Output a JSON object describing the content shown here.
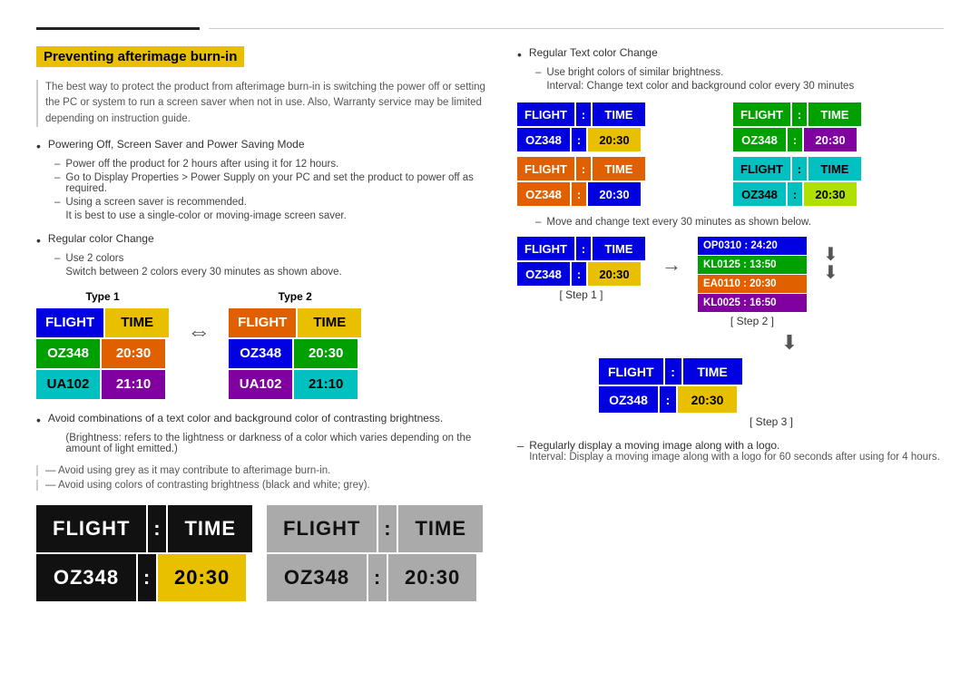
{
  "page": {
    "topLine": {}
  },
  "left": {
    "sectionTitle": "Preventing afterimage burn-in",
    "intro": "The best way to protect the product from afterimage burn-in is switching the power off or setting the PC or system to run a screen saver when not in use. Also, Warranty service may be limited depending on instruction guide.",
    "bullets": [
      {
        "text": "Powering Off, Screen Saver and Power Saving Mode",
        "subs": [
          "Power off the product for 2 hours after using it for 12 hours.",
          "Go to Display Properties > Power Supply on your PC and set the product to power off as required.",
          "Using a screen saver is recommended.",
          "It is best to use a single-color or moving-image screen saver."
        ]
      },
      {
        "text": "Regular color Change",
        "subs": [
          "Use 2 colors",
          "Switch between 2 colors every 30 minutes as shown above."
        ]
      }
    ],
    "type1Label": "Type 1",
    "type2Label": "Type 2",
    "type1Board": {
      "row1": [
        {
          "text": "FLIGHT",
          "color": "blue"
        },
        {
          "text": "TIME",
          "color": "yellow"
        }
      ],
      "row2": [
        {
          "text": "OZ348",
          "color": "green"
        },
        {
          "text": "20:30",
          "color": "orange"
        }
      ],
      "row3": [
        {
          "text": "UA102",
          "color": "cyan"
        },
        {
          "text": "21:10",
          "color": "purple"
        }
      ]
    },
    "type2Board": {
      "row1": [
        {
          "text": "FLIGHT",
          "color": "orange"
        },
        {
          "text": "TIME",
          "color": "yellow"
        }
      ],
      "row2": [
        {
          "text": "OZ348",
          "color": "blue"
        },
        {
          "text": "20:30",
          "color": "green"
        }
      ],
      "row3": [
        {
          "text": "UA102",
          "color": "purple"
        },
        {
          "text": "21:10",
          "color": "cyan"
        }
      ]
    },
    "avoidTexts": [
      "Avoid combinations of a text color and background color of contrasting brightness.",
      "(Brightness: refers to the lightness or darkness of a color which varies depending on the amount of light emitted.)",
      "Avoid using grey as it may contribute to afterimage burn-in.",
      "Avoid using colors of contrasting brightness (black and white; grey)."
    ],
    "largeBoardLeft": {
      "row1": [
        {
          "text": "FLIGHT",
          "color": "lc-black"
        },
        {
          "text": ":",
          "color": "lc-black"
        },
        {
          "text": "TIME",
          "color": "lc-black"
        }
      ],
      "row2": [
        {
          "text": "OZ348",
          "color": "lc-black"
        },
        {
          "text": ":",
          "color": "lc-black"
        },
        {
          "text": "20:30",
          "color": "lc-yellow"
        }
      ]
    },
    "largeBoardRight": {
      "row1": [
        {
          "text": "FLIGHT",
          "color": "lc-gray"
        },
        {
          "text": ":",
          "color": "lc-gray"
        },
        {
          "text": "TIME",
          "color": "lc-gray"
        }
      ],
      "row2": [
        {
          "text": "OZ348",
          "color": "lc-gray"
        },
        {
          "text": ":",
          "color": "lc-gray"
        },
        {
          "text": "20:30",
          "color": "lc-gray"
        }
      ]
    }
  },
  "right": {
    "bullets": [
      {
        "text": "Regular Text color Change",
        "subs": [
          "Use bright colors of similar brightness.",
          "Interval: Change text color and background color every 30 minutes"
        ]
      }
    ],
    "grid": [
      {
        "row1": [
          {
            "text": "FLIGHT",
            "color": "mc-blue"
          },
          {
            "text": ":",
            "color": "mc-blue"
          },
          {
            "text": "TIME",
            "color": "mc-blue"
          }
        ],
        "row2": [
          {
            "text": "OZ348",
            "color": "mc-blue"
          },
          {
            "text": ":",
            "color": "mc-blue"
          },
          {
            "text": "20:30",
            "color": "mc-yellow"
          }
        ]
      },
      {
        "row1": [
          {
            "text": "FLIGHT",
            "color": "mc-green"
          },
          {
            "text": ":",
            "color": "mc-green"
          },
          {
            "text": "TIME",
            "color": "mc-green"
          }
        ],
        "row2": [
          {
            "text": "OZ348",
            "color": "mc-green"
          },
          {
            "text": ":",
            "color": "mc-green"
          },
          {
            "text": "20:30",
            "color": "mc-purple"
          }
        ]
      },
      {
        "row1": [
          {
            "text": "FLIGHT",
            "color": "mc-orange"
          },
          {
            "text": ":",
            "color": "mc-orange"
          },
          {
            "text": "TIME",
            "color": "mc-orange"
          }
        ],
        "row2": [
          {
            "text": "OZ348",
            "color": "mc-orange"
          },
          {
            "text": ":",
            "color": "mc-orange"
          },
          {
            "text": "20:30",
            "color": "mc-blue"
          }
        ]
      },
      {
        "row1": [
          {
            "text": "FLIGHT",
            "color": "mc-cyan"
          },
          {
            "text": ":",
            "color": "mc-cyan"
          },
          {
            "text": "TIME",
            "color": "mc-cyan"
          }
        ],
        "row2": [
          {
            "text": "OZ348",
            "color": "mc-cyan"
          },
          {
            "text": ":",
            "color": "mc-cyan"
          },
          {
            "text": "20:30",
            "color": "mc-lime"
          }
        ]
      }
    ],
    "moveDashText": "Move and change text every 30 minutes as shown below.",
    "step1Label": "[ Step 1 ]",
    "step2Label": "[ Step 2 ]",
    "step3Label": "[ Step 3 ]",
    "step1Board": {
      "row1": [
        {
          "text": "FLIGHT",
          "color": "mc-blue"
        },
        {
          "text": ":",
          "color": "mc-blue"
        },
        {
          "text": "TIME",
          "color": "mc-blue"
        }
      ],
      "row2": [
        {
          "text": "OZ348",
          "color": "mc-blue"
        },
        {
          "text": ":",
          "color": "mc-blue"
        },
        {
          "text": "20:30",
          "color": "mc-yellow"
        }
      ]
    },
    "step2Stacked": [
      {
        "text": "OP0310 : 24:20",
        "color": "sc-blue"
      },
      {
        "text": "KL0125 : 13:50",
        "color": "sc-green"
      },
      {
        "text": "EA0110 : 20:30",
        "color": "sc-orange"
      },
      {
        "text": "KL0025 : 16:50",
        "color": "sc-purple"
      }
    ],
    "step3Board": {
      "row1": [
        {
          "text": "FLIGHT",
          "color": "s3c-blue"
        },
        {
          "text": ":",
          "color": "s3c-blue"
        },
        {
          "text": "TIME",
          "color": "s3c-blue"
        }
      ],
      "row2": [
        {
          "text": "OZ348",
          "color": "s3c-blue"
        },
        {
          "text": ":",
          "color": "s3c-blue"
        },
        {
          "text": "20:30",
          "color": "s3c-yellow"
        }
      ]
    },
    "finalBullets": [
      {
        "dash": "–",
        "text": "Regularly display a moving image along with a logo.",
        "sub": "Interval: Display a moving image along with a logo for 60 seconds after using for 4 hours."
      }
    ]
  }
}
